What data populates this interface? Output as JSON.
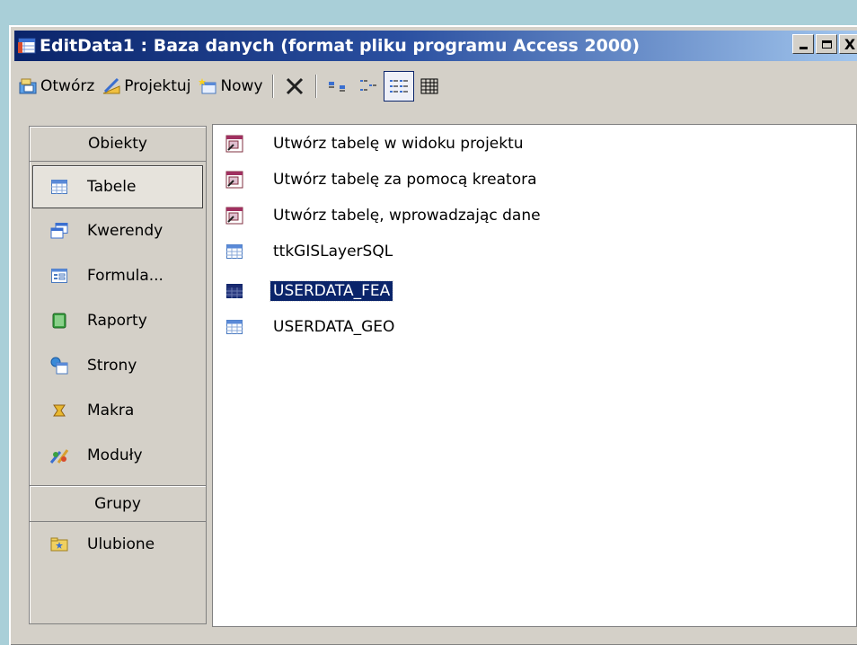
{
  "window": {
    "title": "EditData1 : Baza danych (format pliku programu Access 2000)",
    "controls": {
      "minimize": "_",
      "maximize": "□",
      "close": "X"
    }
  },
  "toolbar": {
    "open_label": "Otwórz",
    "design_label": "Projektuj",
    "new_label": "Nowy",
    "icons": [
      "delete-icon",
      "large-icons-view-icon",
      "small-icons-view-icon",
      "list-view-icon",
      "details-view-icon"
    ]
  },
  "sidebar": {
    "objects_header": "Obiekty",
    "items": [
      {
        "label": "Tabele",
        "icon": "table-icon",
        "selected": true
      },
      {
        "label": "Kwerendy",
        "icon": "query-icon"
      },
      {
        "label": "Formula...",
        "icon": "form-icon"
      },
      {
        "label": "Raporty",
        "icon": "report-icon"
      },
      {
        "label": "Strony",
        "icon": "page-icon"
      },
      {
        "label": "Makra",
        "icon": "macro-icon"
      },
      {
        "label": "Moduły",
        "icon": "module-icon"
      }
    ],
    "groups_header": "Grupy",
    "groups": [
      {
        "label": "Ulubione",
        "icon": "favorites-folder-icon"
      }
    ]
  },
  "list": {
    "items": [
      {
        "label": "Utwórz tabelę w widoku projektu",
        "icon": "create-shortcut-icon"
      },
      {
        "label": "Utwórz tabelę za pomocą kreatora",
        "icon": "create-shortcut-icon"
      },
      {
        "label": "Utwórz tabelę, wprowadzając dane",
        "icon": "create-shortcut-icon"
      },
      {
        "label": "ttkGISLayerSQL",
        "icon": "table-icon"
      },
      {
        "label": "USERDATA_FEA",
        "icon": "table-icon",
        "selected": true
      },
      {
        "label": "USERDATA_GEO",
        "icon": "table-icon"
      }
    ]
  },
  "colors": {
    "titlebar_start": "#0a246a",
    "titlebar_end": "#a6caf0",
    "selection": "#0a246a",
    "face": "#d4d0c8",
    "desktop": "#a9cfd8"
  }
}
